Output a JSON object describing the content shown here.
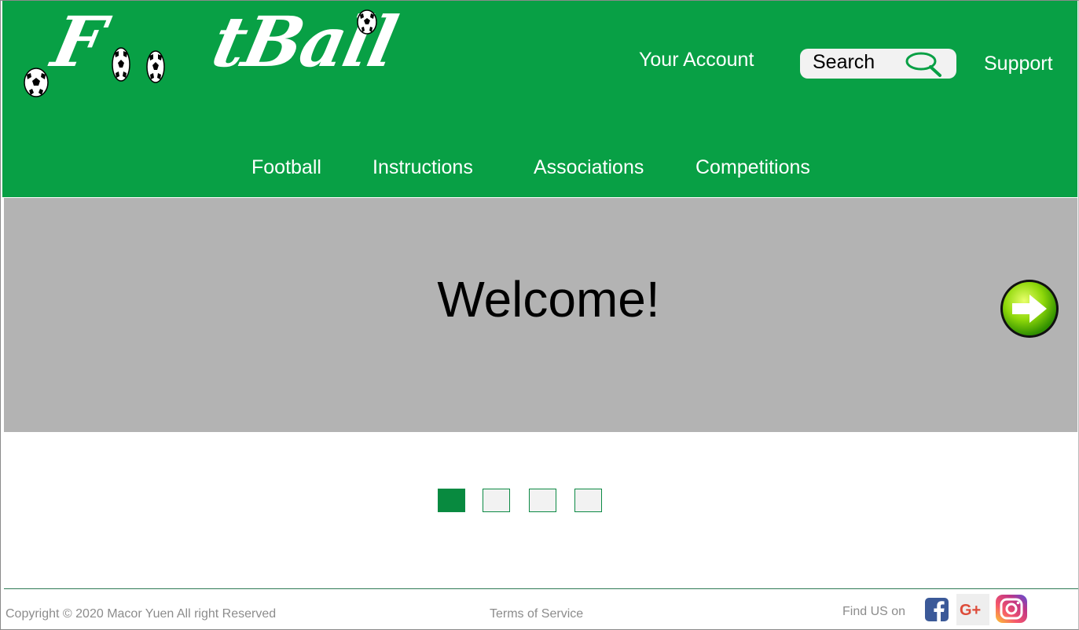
{
  "logo": {
    "text": "FootBall",
    "display": "F  tBall"
  },
  "header": {
    "account_label": "Your Account",
    "search_label": "Search",
    "support_label": "Support",
    "brand_color": "#08a045"
  },
  "nav": {
    "items": [
      {
        "label": "Football"
      },
      {
        "label": "Instructions"
      },
      {
        "label": "Associations"
      },
      {
        "label": "Competitions"
      }
    ]
  },
  "banner": {
    "heading": "Welcome!",
    "next_icon": "arrow-right-icon",
    "background": "#b3b3b3"
  },
  "slider": {
    "active_index": 0,
    "count": 4
  },
  "footer": {
    "copyright": "Copyright © 2020 Macor Yuen All right Reserved",
    "terms": "Terms of Service",
    "find_us": "Find US on",
    "social": [
      "facebook-icon",
      "google-plus-icon",
      "instagram-icon"
    ]
  }
}
